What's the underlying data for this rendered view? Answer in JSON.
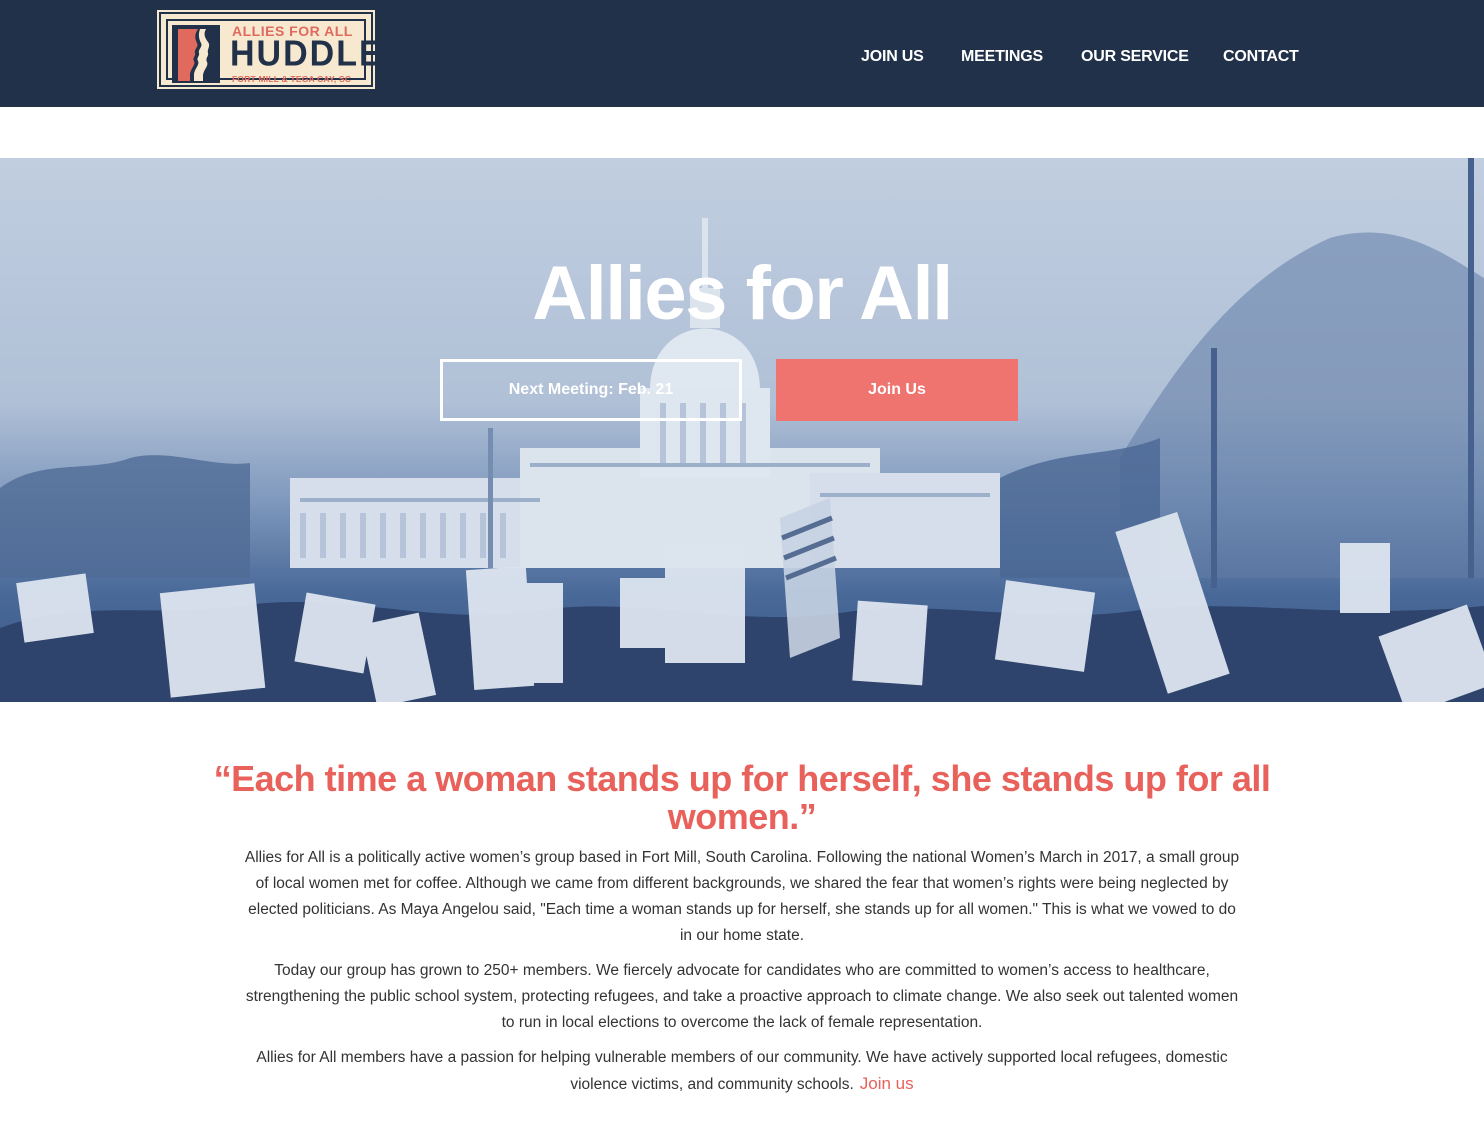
{
  "header": {
    "logo": {
      "top_text": "ALLIES FOR ALL",
      "main_text": "HUDDLE",
      "sub_text": "FORT MILL & TEGA CAY, SC"
    },
    "nav": [
      {
        "label": "JOIN US"
      },
      {
        "label": "MEETINGS"
      },
      {
        "label": "OUR SERVICE"
      },
      {
        "label": "CONTACT"
      }
    ]
  },
  "hero": {
    "title": "Allies for All",
    "next_meeting_button": "Next Meeting: Feb. 21",
    "join_button": "Join Us"
  },
  "content": {
    "quote": "“Each time a woman stands up for herself, she stands up for all women.”",
    "paragraph_1": "Allies for All is a politically active women’s group based in Fort Mill, South Carolina. Following the national Women’s March in 2017, a small group of local women met for coffee. Although we came from different backgrounds, we shared the fear that women’s rights were being neglected by elected politicians. As Maya Angelou said, \"Each time a woman stands up for herself, she stands up for all women.\" This is what we vowed to do in our home state.",
    "paragraph_2": "Today our group has grown to 250+ members. We fiercely advocate for candidates who are committed to women’s access to healthcare, strengthening the public school system, protecting refugees, and take a proactive approach to climate change. We also seek out talented women to run in local elections to overcome the lack of female representation.",
    "paragraph_3": "Allies for All members have a passion for helping vulnerable members of our community. We have actively supported local refugees, domestic violence victims, and community schools.",
    "paragraph_3_link": "Join us"
  },
  "colors": {
    "header_bg": "#22314a",
    "accent": "#e8615b",
    "button_bg": "#ef7470",
    "logo_bg": "#f6e9cf"
  },
  "icons": [
    "women-profiles-logo-icon"
  ]
}
